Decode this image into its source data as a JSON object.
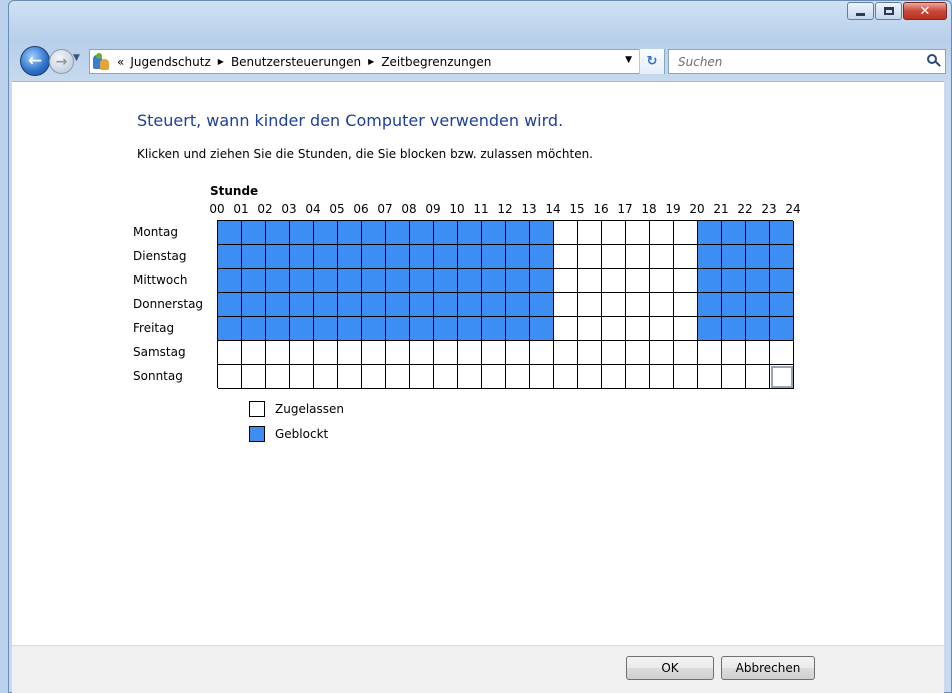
{
  "breadcrumb": {
    "overflow": "«",
    "items": [
      "Jugendschutz",
      "Benutzersteuerungen",
      "Zeitbegrenzungen"
    ]
  },
  "search": {
    "placeholder": "Suchen"
  },
  "page": {
    "title": "Steuert, wann kinder den Computer verwenden wird.",
    "subtitle": "Klicken und ziehen Sie die Stunden, die Sie blocken bzw. zulassen möchten."
  },
  "schedule": {
    "hour_heading": "Stunde",
    "hours": [
      "00",
      "01",
      "02",
      "03",
      "04",
      "05",
      "06",
      "07",
      "08",
      "09",
      "10",
      "11",
      "12",
      "13",
      "14",
      "15",
      "16",
      "17",
      "18",
      "19",
      "20",
      "21",
      "22",
      "23",
      "24"
    ],
    "days": [
      "Montag",
      "Dienstag",
      "Mittwoch",
      "Donnerstag",
      "Freitag",
      "Samstag",
      "Sonntag"
    ],
    "blocked": [
      [
        1,
        1,
        1,
        1,
        1,
        1,
        1,
        1,
        1,
        1,
        1,
        1,
        1,
        1,
        0,
        0,
        0,
        0,
        0,
        0,
        1,
        1,
        1,
        1
      ],
      [
        1,
        1,
        1,
        1,
        1,
        1,
        1,
        1,
        1,
        1,
        1,
        1,
        1,
        1,
        0,
        0,
        0,
        0,
        0,
        0,
        1,
        1,
        1,
        1
      ],
      [
        1,
        1,
        1,
        1,
        1,
        1,
        1,
        1,
        1,
        1,
        1,
        1,
        1,
        1,
        0,
        0,
        0,
        0,
        0,
        0,
        1,
        1,
        1,
        1
      ],
      [
        1,
        1,
        1,
        1,
        1,
        1,
        1,
        1,
        1,
        1,
        1,
        1,
        1,
        1,
        0,
        0,
        0,
        0,
        0,
        0,
        1,
        1,
        1,
        1
      ],
      [
        1,
        1,
        1,
        1,
        1,
        1,
        1,
        1,
        1,
        1,
        1,
        1,
        1,
        1,
        0,
        0,
        0,
        0,
        0,
        0,
        1,
        1,
        1,
        1
      ],
      [
        0,
        0,
        0,
        0,
        0,
        0,
        0,
        0,
        0,
        0,
        0,
        0,
        0,
        0,
        0,
        0,
        0,
        0,
        0,
        0,
        0,
        0,
        0,
        0
      ],
      [
        0,
        0,
        0,
        0,
        0,
        0,
        0,
        0,
        0,
        0,
        0,
        0,
        0,
        0,
        0,
        0,
        0,
        0,
        0,
        0,
        0,
        0,
        0,
        0
      ]
    ],
    "blocked_color": "#3c8ef2",
    "allowed_color": "#ffffff"
  },
  "legend": {
    "allowed": "Zugelassen",
    "blocked": "Geblockt"
  },
  "buttons": {
    "ok": "OK",
    "cancel": "Abbrechen"
  }
}
